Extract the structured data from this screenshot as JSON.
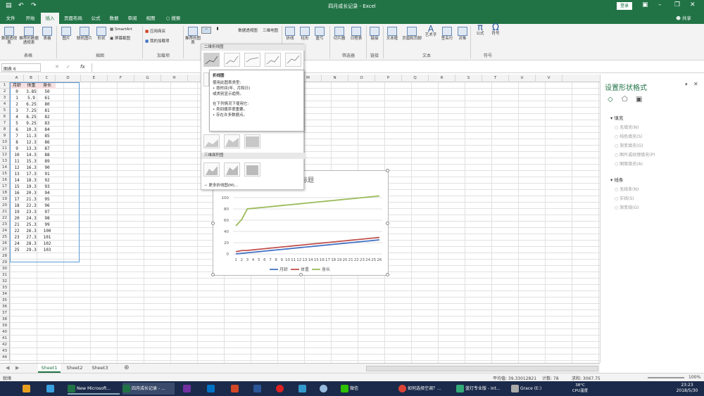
{
  "window": {
    "title": "四月成长记录 - Excel",
    "login": "登录",
    "share": "共享"
  },
  "tabs": [
    "文件",
    "开始",
    "插入",
    "页面布局",
    "公式",
    "数据",
    "审阅",
    "视图",
    "搜索"
  ],
  "active_tab": "插入",
  "ribbon": {
    "buttons": [
      "数据透视表",
      "推荐的数据透视表",
      "表格",
      "图片",
      "联机图片",
      "形状",
      "SmartArt",
      "屏幕截图",
      "应用商店",
      "我的加载项",
      "推荐的图表",
      "数据透视图",
      "三维地图",
      "折线",
      "柱形",
      "盈亏",
      "切片器",
      "日程表",
      "链接",
      "文本框",
      "页眉和页脚",
      "艺术字",
      "签名行",
      "对象",
      "公式",
      "符号"
    ],
    "groups": [
      "表格",
      "插图",
      "加载项",
      "筛选器",
      "链接",
      "文本",
      "符号"
    ]
  },
  "formula_bar": {
    "name_box": "图表 6",
    "fx": "fx"
  },
  "columns": [
    "A",
    "B",
    "C",
    "D",
    "E",
    "F",
    "G",
    "H",
    "I",
    "J",
    "K",
    "L",
    "M",
    "N",
    "O",
    "P",
    "Q",
    "R",
    "S",
    "T",
    "U",
    "V"
  ],
  "table": {
    "headers": [
      "月龄",
      "体重",
      "身长"
    ],
    "rows": [
      [
        "0",
        "3.85",
        "50"
      ],
      [
        "1",
        "5.9",
        "61"
      ],
      [
        "2",
        "6.25",
        "80"
      ],
      [
        "3",
        "7.25",
        "81"
      ],
      [
        "4",
        "8.25",
        "82"
      ],
      [
        "5",
        "9.25",
        "83"
      ],
      [
        "6",
        "10.3",
        "84"
      ],
      [
        "7",
        "11.3",
        "85"
      ],
      [
        "8",
        "12.3",
        "86"
      ],
      [
        "9",
        "13.3",
        "87"
      ],
      [
        "10",
        "14.3",
        "88"
      ],
      [
        "11",
        "15.3",
        "89"
      ],
      [
        "12",
        "16.3",
        "90"
      ],
      [
        "13",
        "17.3",
        "91"
      ],
      [
        "14",
        "18.3",
        "92"
      ],
      [
        "15",
        "19.3",
        "93"
      ],
      [
        "16",
        "20.3",
        "94"
      ],
      [
        "17",
        "21.3",
        "95"
      ],
      [
        "18",
        "22.3",
        "96"
      ],
      [
        "19",
        "23.3",
        "97"
      ],
      [
        "20",
        "24.3",
        "98"
      ],
      [
        "21",
        "25.3",
        "99"
      ],
      [
        "22",
        "26.3",
        "100"
      ],
      [
        "23",
        "27.3",
        "101"
      ],
      [
        "24",
        "28.3",
        "102"
      ],
      [
        "25",
        "29.3",
        "103"
      ]
    ]
  },
  "chart_data": {
    "type": "line",
    "title": "图表标题",
    "categories": [
      "1",
      "2",
      "3",
      "4",
      "5",
      "6",
      "7",
      "8",
      "9",
      "10",
      "11",
      "12",
      "13",
      "14",
      "15",
      "16",
      "17",
      "18",
      "19",
      "20",
      "21",
      "22",
      "23",
      "24",
      "25",
      "26"
    ],
    "ylim": [
      0,
      100
    ],
    "yticks": [
      "0",
      "20",
      "40",
      "60",
      "80",
      "100"
    ],
    "series": [
      {
        "name": "月龄",
        "color": "#4472c4",
        "values": [
          0,
          1,
          2,
          3,
          4,
          5,
          6,
          7,
          8,
          9,
          10,
          11,
          12,
          13,
          14,
          15,
          16,
          17,
          18,
          19,
          20,
          21,
          22,
          23,
          24,
          25
        ]
      },
      {
        "name": "体重",
        "color": "#c0504d",
        "values": [
          3.85,
          5.9,
          6.25,
          7.25,
          8.25,
          9.25,
          10.3,
          11.3,
          12.3,
          13.3,
          14.3,
          15.3,
          16.3,
          17.3,
          18.3,
          19.3,
          20.3,
          21.3,
          22.3,
          23.3,
          24.3,
          25.3,
          26.3,
          27.3,
          28.3,
          29.3
        ]
      },
      {
        "name": "身长",
        "color": "#9bbb59",
        "values": [
          50,
          61,
          80,
          81,
          82,
          83,
          84,
          85,
          86,
          87,
          88,
          89,
          90,
          91,
          92,
          93,
          94,
          95,
          96,
          97,
          98,
          99,
          100,
          101,
          102,
          103
        ]
      }
    ],
    "legend": "bottom"
  },
  "dropdown": {
    "header_2d": "二维折线图",
    "header_3d": "三维面积图",
    "more": "更多折线图(M)..."
  },
  "tooltip": {
    "title": "折线图",
    "lines": [
      "使用此图表类型:",
      "• 按时间(年、月和日)",
      "  或类别显示趋势。",
      "",
      "在下列情况下使用它:",
      "• 类别顺序很重要。",
      "• 存在许多数据点。"
    ]
  },
  "pane": {
    "title": "设置形状格式",
    "fill_header": "填充",
    "fill_options": [
      "无填充(N)",
      "纯色填充(S)",
      "渐变填充(G)",
      "图片或纹理填充(P)",
      "图案填充(A)"
    ],
    "line_header": "线条",
    "line_options": [
      "无线条(N)",
      "实线(S)",
      "渐变线(G)"
    ]
  },
  "sheets": [
    "Sheet1",
    "Sheet2",
    "Sheet3"
  ],
  "status": {
    "mode": "就绪",
    "average": "平均值: 39.33012821",
    "count": "计数: 78",
    "sum": "求和: 3067.75",
    "zoom": "100%"
  },
  "taskbar": {
    "items": [
      "New Microsoft...",
      "四月成长记录 - ...",
      "微信",
      "如何选择空调？...",
      "蓝灯专业版 - Int...",
      "Grace (E:)"
    ],
    "temp": "38°C",
    "temp_label": "CPU温度",
    "time": "23:23",
    "date": "2018/5/30"
  }
}
